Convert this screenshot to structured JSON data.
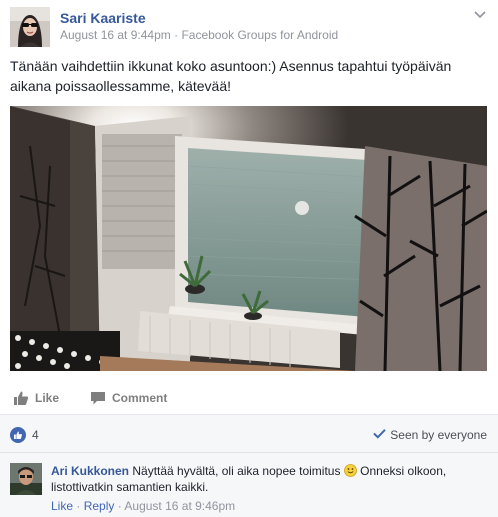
{
  "post": {
    "author": "Sari Kaariste",
    "date": "August 16 at 9:44pm",
    "separator": "·",
    "source": "Facebook Groups for Android",
    "text": "Tänään vaihdettiin ikkunat koko asuntoon:) Asennus tapahtui työpäivän aikana poissaollessamme, kätevää!"
  },
  "actions": {
    "like": "Like",
    "comment": "Comment"
  },
  "reactions": {
    "like_count": "4",
    "seen_label": "Seen by everyone"
  },
  "comment": {
    "author": "Ari Kukkonen",
    "text_before_emoji": "Näyttää hyvältä, oli aika nopee toimitus",
    "text_after_emoji": "Onneksi olkoon, listottivatkin samantien kaikki.",
    "like": "Like",
    "reply": "Reply",
    "separator": "·",
    "date": "August 16 at 9:46pm"
  },
  "icons": {
    "menu": "chevron-down-icon",
    "like": "thumbs-up-icon",
    "comment": "speech-bubble-icon",
    "seen": "checkmark-icon",
    "emoji": "smiley-emoji-icon"
  },
  "colors": {
    "link_blue": "#365899",
    "brand_blue": "#4267b2",
    "meta_gray": "#90949c",
    "panel_bg": "#f6f7f9"
  }
}
